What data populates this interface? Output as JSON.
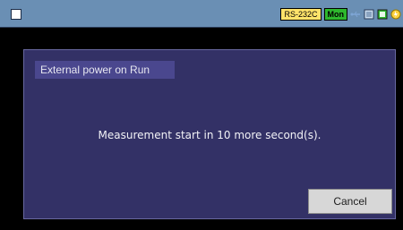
{
  "status_bar": {
    "interface_badge": "RS-232C",
    "mode_badge": "Mon",
    "icons": [
      "usb-icon",
      "network-icon",
      "storage-icon",
      "power-icon"
    ],
    "colors": {
      "bar": "#6a8fb4",
      "rs_badge": "#ffe36a",
      "mon_badge": "#2eb82e"
    }
  },
  "dialog": {
    "title": "External power on Run",
    "message": "Measurement start in 10 more second(s).",
    "cancel_label": "Cancel",
    "colors": {
      "background": "#333166",
      "title_background": "#4a478e",
      "button_background": "#d7d7d7"
    }
  }
}
